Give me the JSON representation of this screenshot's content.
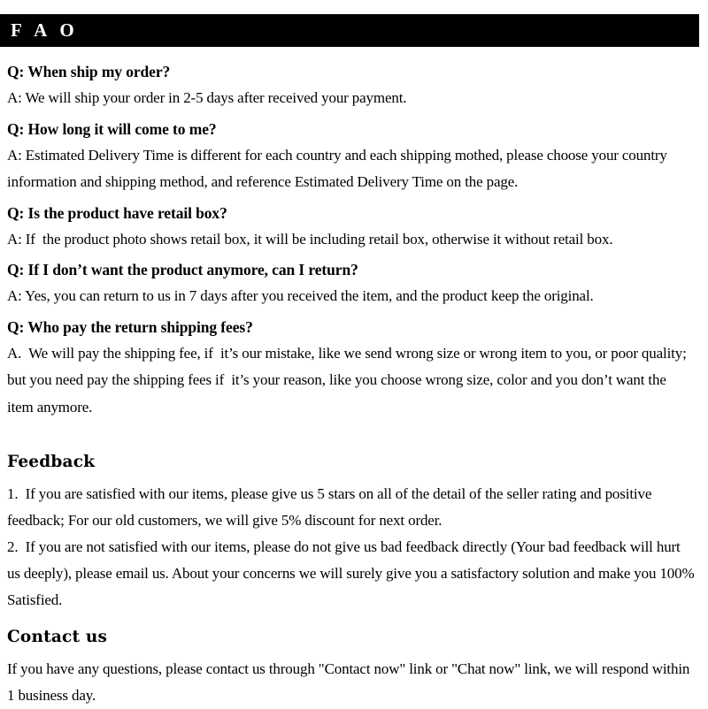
{
  "banner": {
    "title": "F A O",
    "background_color": "#000000",
    "text_color": "#ffffff"
  },
  "faq": {
    "items": [
      {
        "question": "Q: When ship my order?",
        "answer": "A: We will ship your order in 2-5 days after received your payment."
      },
      {
        "question": "Q: How long it will come to me?",
        "answer": "A: Estimated Delivery Time is different for each country and each shipping mothed, please choose your country information and shipping method, and reference Estimated Delivery Time on the page."
      },
      {
        "question": "Q: Is the product have retail box?",
        "answer": "A: If  the product photo shows retail box, it will be including retail box, otherwise it without retail box."
      },
      {
        "question": "Q: If I don’t want the product anymore, can I return?",
        "answer": "A: Yes, you can return to us in 7 days after you received the item, and the product keep the original."
      },
      {
        "question": "Q: Who pay the return shipping fees?",
        "answer": "A.  We will pay the shipping fee, if  it’s our mistake, like we send wrong size or wrong item to you, or poor quality; but you need pay the shipping fees if  it’s your reason, like you choose wrong size, color and you don’t want the item anymore."
      }
    ]
  },
  "feedback": {
    "heading": "Feedback",
    "paragraphs": [
      "1.  If you are satisfied with our items, please give us 5 stars on all of the detail of the seller rating and positive feedback; For our old customers, we will give 5% discount for next order.",
      "2.  If you are not satisfied with our items, please do not give us bad feedback directly (Your bad feedback will hurt us deeply), please email us. About your concerns we will surely give you a satisfactory solution and make you 100% Satisfied."
    ]
  },
  "contact": {
    "heading": "Contact us",
    "paragraphs": [
      "If you have any questions, please contact us through \"Contact now\" link or \"Chat now\" link, we will respond within 1 business day."
    ]
  }
}
